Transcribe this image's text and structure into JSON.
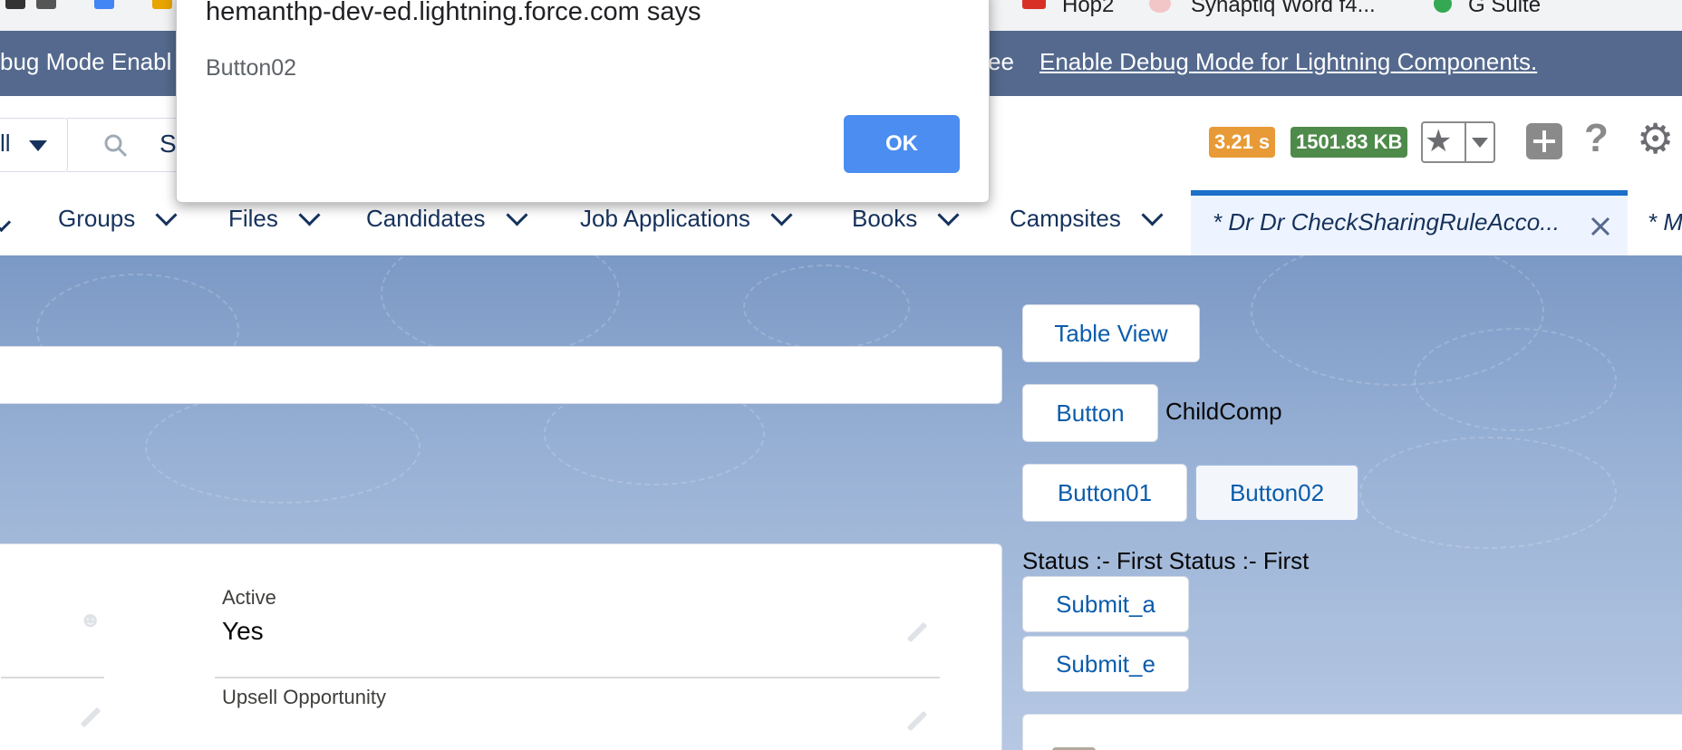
{
  "bookmarks": [
    {
      "label": "Hop2",
      "icon": "folder-icon"
    },
    {
      "label": "Synaptiq Word f4...",
      "icon": "synaptiq-icon"
    },
    {
      "label": "G Suite",
      "icon": "gsuite-icon"
    }
  ],
  "debug_banner": {
    "left_text": "bug Mode Enabl",
    "right_text": "ee",
    "link": "Enable Debug Mode for Lightning Components."
  },
  "header": {
    "scope_label": "ll",
    "search_text": "S",
    "timing_badge": "3.21 s",
    "size_badge": "1501.83 KB",
    "colors": {
      "timing": "#e89a36",
      "size": "#4e8a4a"
    }
  },
  "nav": {
    "items": [
      "Groups",
      "Files",
      "Candidates",
      "Job Applications",
      "Books",
      "Campsites"
    ],
    "active_tab": "* Dr Dr CheckSharingRuleAcco...",
    "next_tab": "* M"
  },
  "right_panel": {
    "table_view": "Table View",
    "button": "Button",
    "child_comp": "ChildComp",
    "button01": "Button01",
    "button02": "Button02",
    "status": "Status :- First Status :- First",
    "submit_a": "Submit_a",
    "submit_e": "Submit_e"
  },
  "record": {
    "active_label": "Active",
    "active_value": "Yes",
    "upsell_label": "Upsell Opportunity",
    "upsell_value": ""
  },
  "dialog": {
    "title": "hemanthp-dev-ed.lightning.force.com says",
    "message": "Button02",
    "ok": "OK"
  }
}
